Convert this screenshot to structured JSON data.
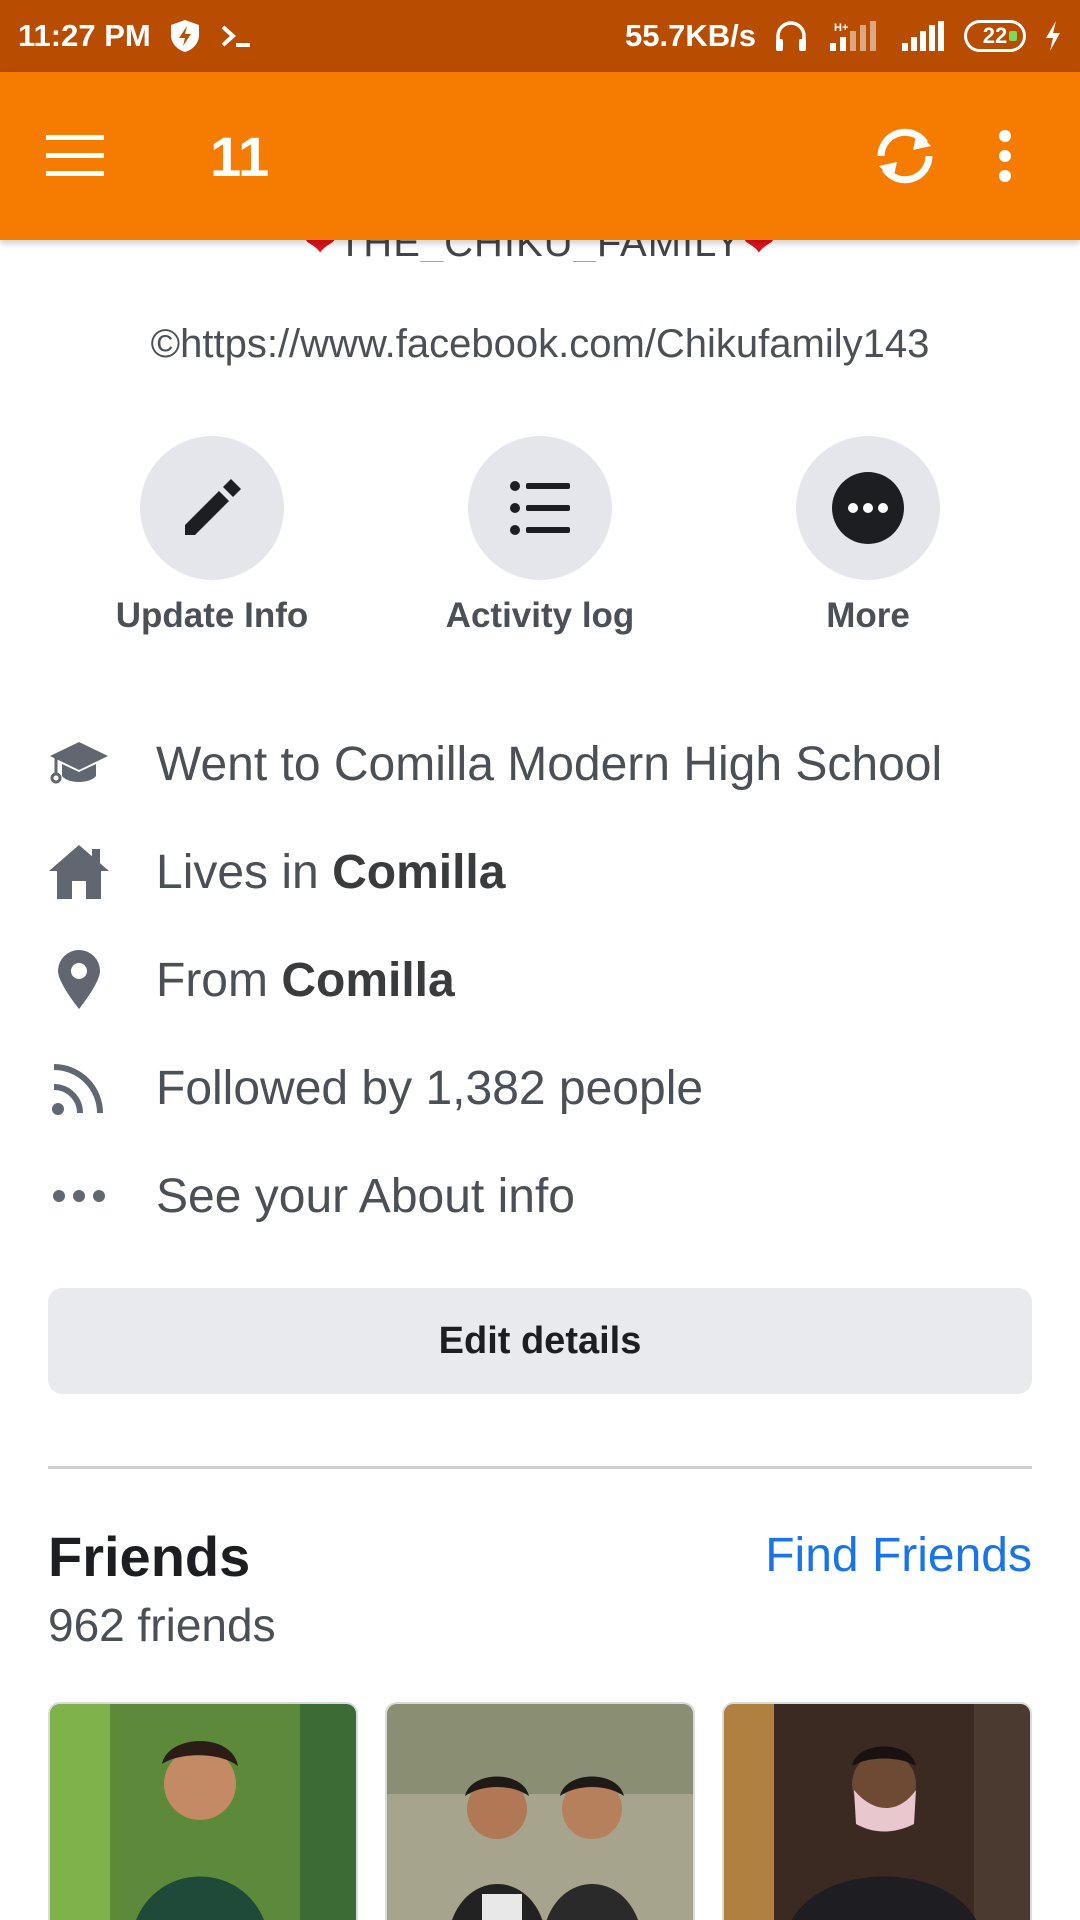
{
  "status_bar": {
    "time": "11:27 PM",
    "speed": "55.7KB/s",
    "battery": "22"
  },
  "app_bar": {
    "title": "11"
  },
  "profile": {
    "name_partial": "THE_CHIKU_FAMILY",
    "bio": "©https://www.facebook.com/Chikufamily143"
  },
  "actions": [
    {
      "label": "Update Info",
      "icon": "pencil-icon"
    },
    {
      "label": "Activity log",
      "icon": "list-icon"
    },
    {
      "label": "More",
      "icon": "more-dots-icon"
    }
  ],
  "info": {
    "school": "Went to Comilla Modern High School",
    "lives_prefix": "Lives in ",
    "lives_place": "Comilla",
    "from_prefix": "From ",
    "from_place": "Comilla",
    "followed": "Followed by 1,382 people",
    "about": "See your About info"
  },
  "edit_button": "Edit details",
  "friends": {
    "title": "Friends",
    "find_link": "Find Friends",
    "count": "962 friends"
  },
  "colors": {
    "status_bar": "#b84c00",
    "app_bar": "#f57c00",
    "link": "#1b74e4",
    "button_bg": "#e9eaee"
  }
}
